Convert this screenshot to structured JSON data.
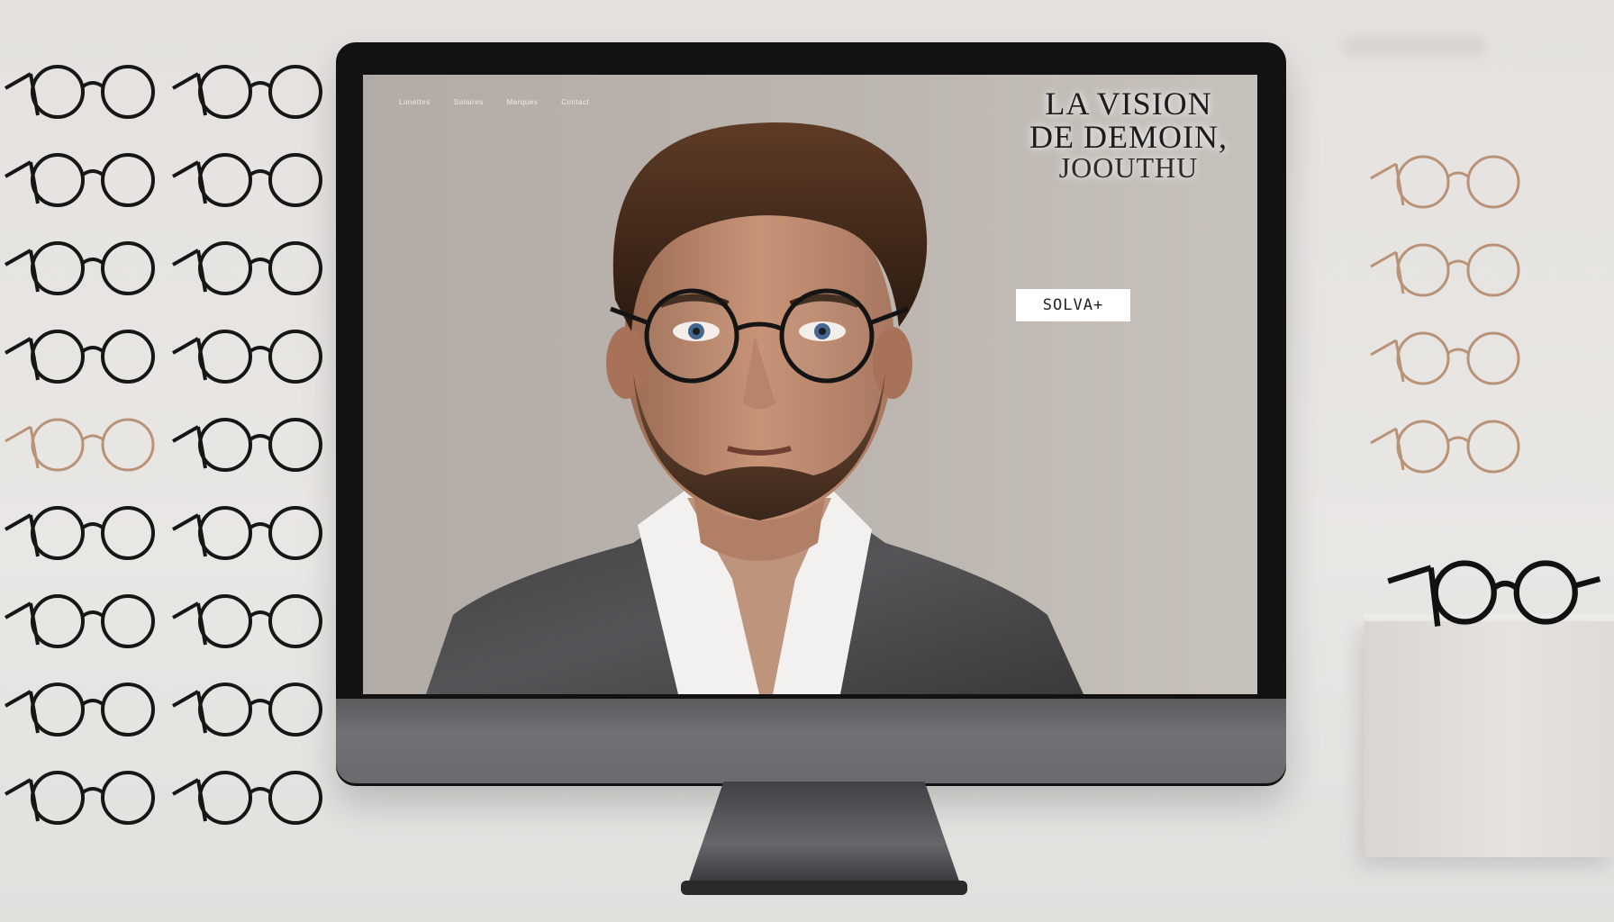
{
  "nav": {
    "items": [
      "Lunettes",
      "Solaires",
      "Marques",
      "Contact"
    ]
  },
  "hero": {
    "headline_line1": "LA VISION",
    "headline_line2": "DE DEMOIN,",
    "headline_line3": "JOOUTHU",
    "lede": "",
    "cta_label": "SOLVA+"
  },
  "colors": {
    "screen_bg": "#b8b0aa",
    "bezel": "#121212",
    "wall": "#e6e3e0",
    "frame_black": "#161616",
    "frame_gold": "#b89378"
  },
  "icons": [
    "glasses-icon"
  ]
}
